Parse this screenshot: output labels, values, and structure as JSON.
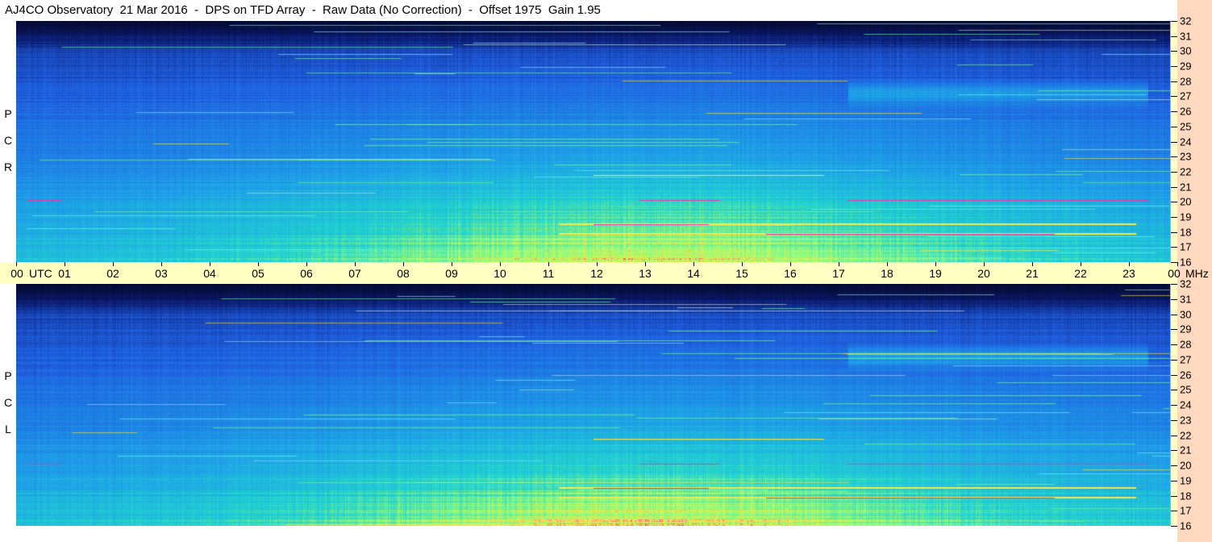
{
  "title": "AJ4CO Observatory  21 Mar 2016  -  DPS on TFD Array  -  Raw Data (No Correction)  -  Offset 1975  Gain 1.95",
  "panels": [
    {
      "name": "RCP",
      "letters": [
        "P",
        "C",
        "R"
      ]
    },
    {
      "name": "LCP",
      "letters": [
        "P",
        "C",
        "L"
      ]
    }
  ],
  "time_axis": {
    "utc_label": "UTC",
    "ticks": [
      "00",
      "01",
      "02",
      "03",
      "04",
      "05",
      "06",
      "07",
      "08",
      "09",
      "10",
      "11",
      "12",
      "13",
      "14",
      "15",
      "16",
      "17",
      "18",
      "19",
      "20",
      "21",
      "22",
      "23",
      "00"
    ]
  },
  "freq_axis": {
    "unit_label": "MHz",
    "ticks": [
      "32",
      "31",
      "30",
      "29",
      "28",
      "27",
      "26",
      "25",
      "24",
      "23",
      "22",
      "21",
      "20",
      "19",
      "18",
      "17",
      "16"
    ]
  },
  "colors": {
    "background": "#ffffff",
    "axis_band": "#ffffc2",
    "right_strip": "#ffd9bf",
    "low_intensity": "#0a1a6e",
    "mid_intensity": "#1f5fe0",
    "high_intensity": "#21d4d0",
    "hot": "#ffe640",
    "peak": "#ff30a0"
  }
}
